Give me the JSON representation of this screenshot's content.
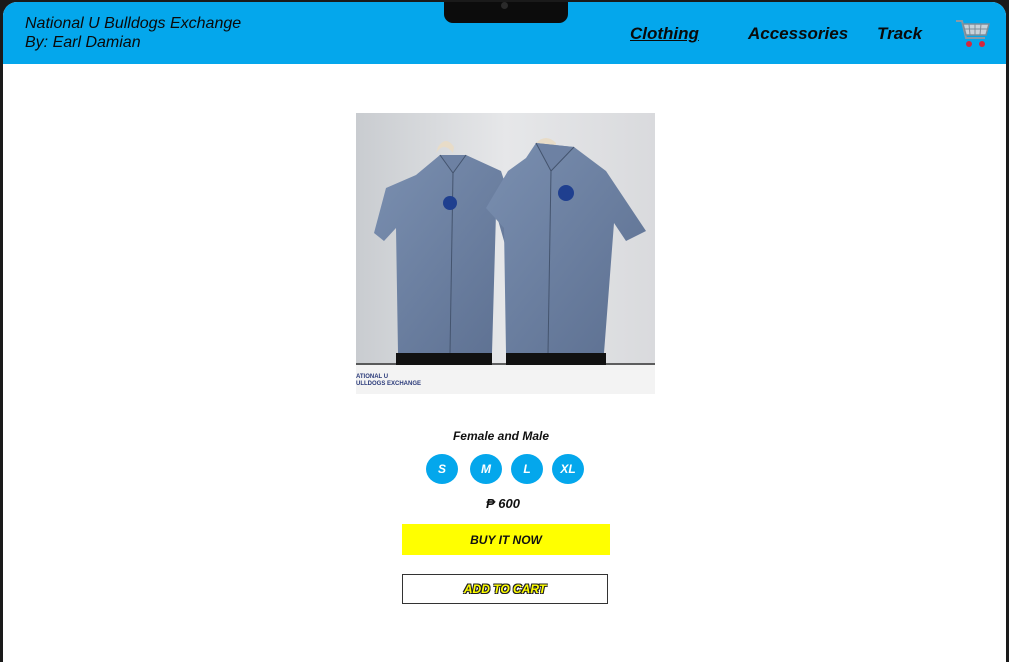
{
  "header": {
    "brand_line1": "National U Bulldogs Exchange",
    "brand_line2": "By: Earl Damian",
    "nav": [
      "Clothing",
      "Accessories",
      "Track"
    ],
    "cart_icon": "shopping-cart-icon"
  },
  "product": {
    "image_caption_line1": "ATIONAL U",
    "image_caption_line2": "ULLDOGS EXCHANGE",
    "subtitle": "Female and Male",
    "sizes": [
      "S",
      "M",
      "L",
      "XL"
    ],
    "price": "₱ 600",
    "buy_label": "BUY IT NOW",
    "add_cart_label": "ADD TO CART"
  },
  "colors": {
    "header_bg": "#04a7ec",
    "size_bg": "#04a7ec",
    "buy_bg": "#ffff00"
  }
}
